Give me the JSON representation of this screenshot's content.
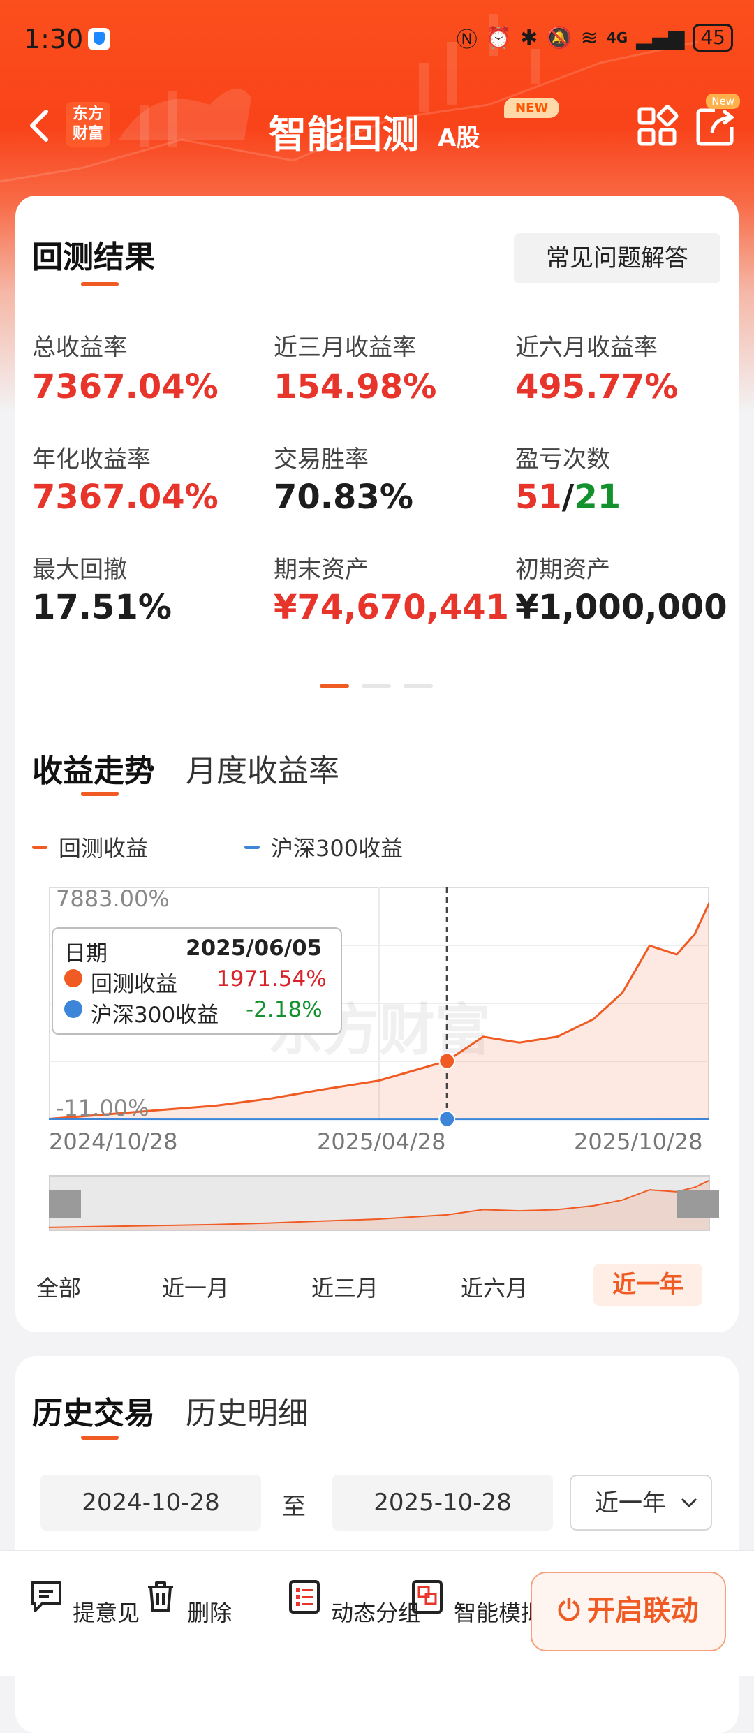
{
  "status_bar": {
    "time": "1:30",
    "network": "4G",
    "battery": "45"
  },
  "nav": {
    "logo_line1": "东方",
    "logo_line2": "财富",
    "title": "智能回测",
    "title_suffix": "A股",
    "new_tag": "NEW",
    "share_new_tag": "New"
  },
  "results": {
    "title": "回测结果",
    "faq_button": "常见问题解答",
    "metrics": [
      {
        "label": "总收益率",
        "value": "7367.04%"
      },
      {
        "label": "近三月收益率",
        "value": "154.98%"
      },
      {
        "label": "近六月收益率",
        "value": "495.77%"
      },
      {
        "label": "年化收益率",
        "value": "7367.04%"
      },
      {
        "label": "交易胜率",
        "value": "70.83%"
      },
      {
        "label": "盈亏次数",
        "win": "51",
        "sep": "/",
        "loss": "21"
      },
      {
        "label": "最大回撤",
        "value": "17.51%"
      },
      {
        "label": "期末资产",
        "value": "¥74,670,441"
      },
      {
        "label": "初期资产",
        "value": "¥1,000,000"
      }
    ]
  },
  "trend": {
    "tab_active": "收益走势",
    "tab_other": "月度收益率",
    "legend_backtest": "回测收益",
    "legend_index": "沪深300收益",
    "y_max_label": "7883.00%",
    "y_min_label": "-11.00%",
    "x_labels": [
      "2024/10/28",
      "2025/04/28",
      "2025/10/28"
    ],
    "watermark": "东方财富",
    "tooltip": {
      "date_label": "日期",
      "date_value": "2025/06/05",
      "backtest_label": "回测收益",
      "backtest_value": "1971.54%",
      "index_label": "沪深300收益",
      "index_value": "-2.18%"
    },
    "ranges": [
      "全部",
      "近一月",
      "近三月",
      "近六月",
      "近一年"
    ],
    "active_range": "近一年"
  },
  "history": {
    "tab_active": "历史交易",
    "tab_other": "历史明细",
    "start_date": "2024-10-28",
    "to_label": "至",
    "end_date": "2025-10-28",
    "period_select": "近一年"
  },
  "bottom_bar": {
    "feedback": "提意见",
    "delete": "删除",
    "dynamic_group": "动态分组",
    "smart_sim": "智能模拟",
    "link_button": "开启联动"
  },
  "colors": {
    "accent": "#f05a23",
    "gain": "#e8352c",
    "loss": "#13912d",
    "index_line": "#3d85d9"
  },
  "chart_data": {
    "type": "line",
    "x_range": [
      "2024/10/28",
      "2025/10/28"
    ],
    "ylim": [
      -11.0,
      7883.0
    ],
    "series": [
      {
        "name": "回测收益",
        "x": [
          "2024/10/28",
          "2024/11/28",
          "2024/12/28",
          "2025/01/28",
          "2025/02/28",
          "2025/03/28",
          "2025/04/28",
          "2025/05/15",
          "2025/06/05",
          "2025/06/25",
          "2025/07/15",
          "2025/08/05",
          "2025/08/25",
          "2025/09/10",
          "2025/09/25",
          "2025/10/10",
          "2025/10/20",
          "2025/10/28"
        ],
        "values": [
          0,
          150,
          300,
          450,
          700,
          1000,
          1300,
          1600,
          1971.54,
          2800,
          2600,
          2800,
          3400,
          4300,
          5900,
          5600,
          6300,
          7367.04
        ]
      },
      {
        "name": "沪深300收益",
        "x": [
          "2024/10/28",
          "2025/06/05",
          "2025/10/28"
        ],
        "values": [
          0,
          -2.18,
          0
        ]
      }
    ]
  }
}
